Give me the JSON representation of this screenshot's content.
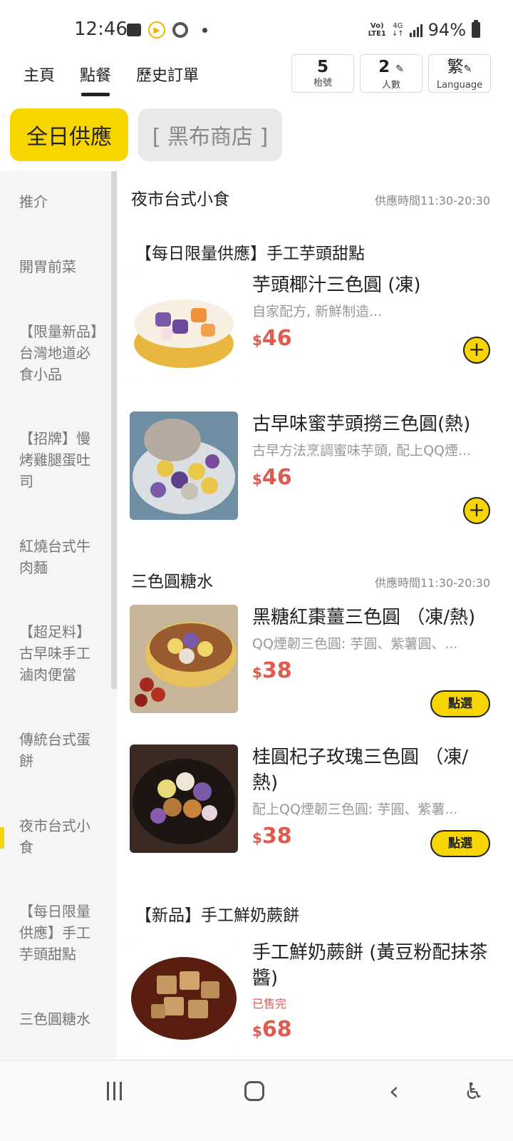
{
  "status_bar": {
    "time": "12:46",
    "network_top": "Vo)",
    "network_bottom": "LTE1",
    "lte_top": "4G",
    "lte_bottom": "↓↑",
    "battery": "94%"
  },
  "nav": {
    "tabs": [
      "主頁",
      "點餐",
      "歷史訂單"
    ],
    "active_tab": "點餐",
    "table_number": "5",
    "table_label": "枱號",
    "people_count": "2",
    "people_label": "人數",
    "lang_char": "繁",
    "lang_label": "Language"
  },
  "menus": {
    "active": "全日供應",
    "other": "[ 黑布商店 ]"
  },
  "sidebar": {
    "items": [
      "推介",
      "開胃前菜",
      "【限量新品】台灣地道必食小品",
      "【招牌】慢烤雞腿蛋吐司",
      "紅燒台式牛肉麵",
      "【超足料】古早味手工滷肉便當",
      "傳統台式蛋餅",
      "夜市台式小食",
      "【每日限量供應】手工芋頭甜點",
      "三色圓糖水"
    ],
    "active_item": "夜市台式小食"
  },
  "sections": {
    "night_market": {
      "title": "夜市台式小食",
      "time": "供應時間11:30-20:30"
    },
    "taro_dessert": {
      "title": "【每日限量供應】手工芋頭甜點"
    },
    "three_color": {
      "title": "三色圓糖水",
      "time": "供應時間11:30-20:30"
    },
    "warabi": {
      "title": "【新品】手工鮮奶蕨餅"
    }
  },
  "items": [
    {
      "name": "芋頭椰汁三色圓 (凍)",
      "desc": "自家配方, 新鮮制造...",
      "currency": "$",
      "price": "46",
      "action": "+"
    },
    {
      "name": "古早味蜜芋頭撈三色圓(熱)",
      "desc": "古早方法烹調蜜味芋頭, 配上QQ煙...",
      "currency": "$",
      "price": "46",
      "action": "+"
    },
    {
      "name": "黑糖紅棗薑三色圓 （凍/熱)",
      "desc": "QQ煙韌三色圓: 芋圓、紫薯圓、...",
      "currency": "$",
      "price": "38",
      "action": "點選"
    },
    {
      "name": "桂圓杞子玫瑰三色圓 （凍/熱)",
      "desc": "配上QQ煙韌三色圓: 芋圓、紫薯...",
      "currency": "$",
      "price": "38",
      "action": "點選"
    },
    {
      "name": "手工鮮奶蕨餅 (黃豆粉配抹茶醬)",
      "sold_out": "已售完",
      "currency": "$",
      "price": "68"
    }
  ],
  "colors": {
    "accent": "#f7d500",
    "price": "#e05a4e"
  }
}
